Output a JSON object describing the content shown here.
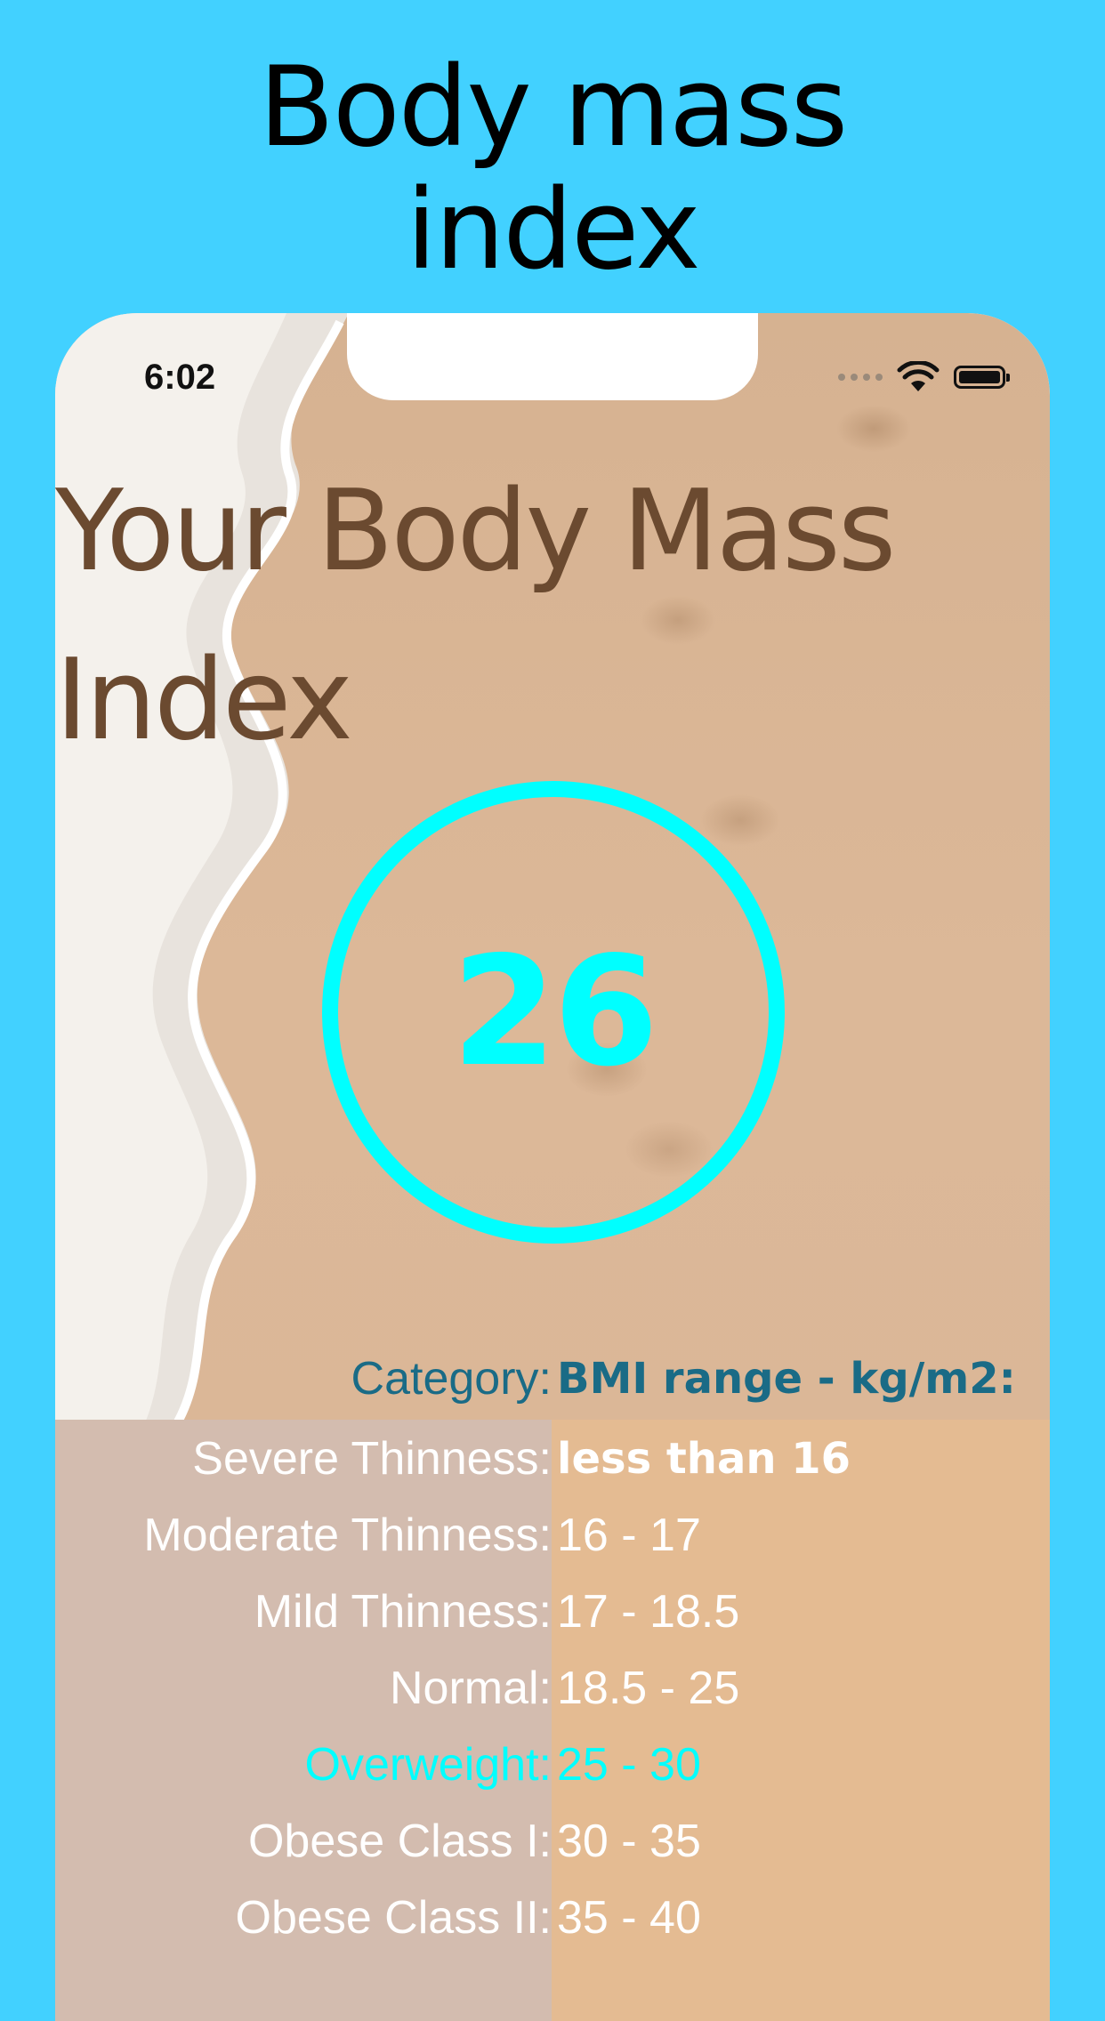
{
  "promo": {
    "title_line1": "Body mass",
    "title_line2": "index",
    "background": "#42d1ff"
  },
  "status_bar": {
    "time": "6:02",
    "icons": [
      "signal-icon",
      "wifi-icon",
      "battery-icon"
    ]
  },
  "screen": {
    "title_line1": "Your Body Mass",
    "title_line2": "Index",
    "bmi_value": "26",
    "accent_color": "#00ffff"
  },
  "table": {
    "header_category": "Category:",
    "header_range": "BMI range - kg/m2:",
    "rows": [
      {
        "category": "Severe Thinness:",
        "range": "less than 16"
      },
      {
        "category": "Moderate Thinness:",
        "range": "16 - 17"
      },
      {
        "category": "Mild Thinness:",
        "range": "17 - 18.5"
      },
      {
        "category": "Normal:",
        "range": "18.5 - 25"
      },
      {
        "category": "Overweight:",
        "range": "25 - 30",
        "highlighted": true
      },
      {
        "category": "Obese Class I:",
        "range": "30 - 35"
      },
      {
        "category": "Obese Class II:",
        "range": "35 - 40"
      }
    ]
  }
}
